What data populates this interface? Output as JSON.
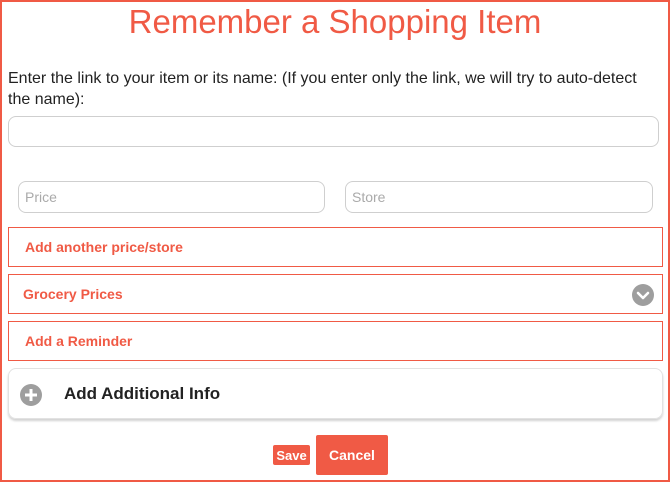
{
  "title": "Remember a Shopping Item",
  "instruction": "Enter the link to your item or its name: (If you enter only the link, we will try to auto-detect the name):",
  "link_input": {
    "value": "",
    "placeholder": ""
  },
  "price_input": {
    "value": "",
    "placeholder": "Price"
  },
  "store_input": {
    "value": "",
    "placeholder": "Store"
  },
  "add_price_label": "Add another price/store",
  "grocery_label": "Grocery Prices",
  "reminder_label": "Add a Reminder",
  "additional_info_label": "Add Additional Info",
  "save_label": "Save",
  "cancel_label": "Cancel",
  "icons": {
    "grocery_toggle": "chevron-down-icon",
    "additional_info": "plus-circle-icon"
  },
  "colors": {
    "accent": "#f05a45",
    "icon_gray": "#9e9e9e",
    "border": "#cfcfcf"
  }
}
